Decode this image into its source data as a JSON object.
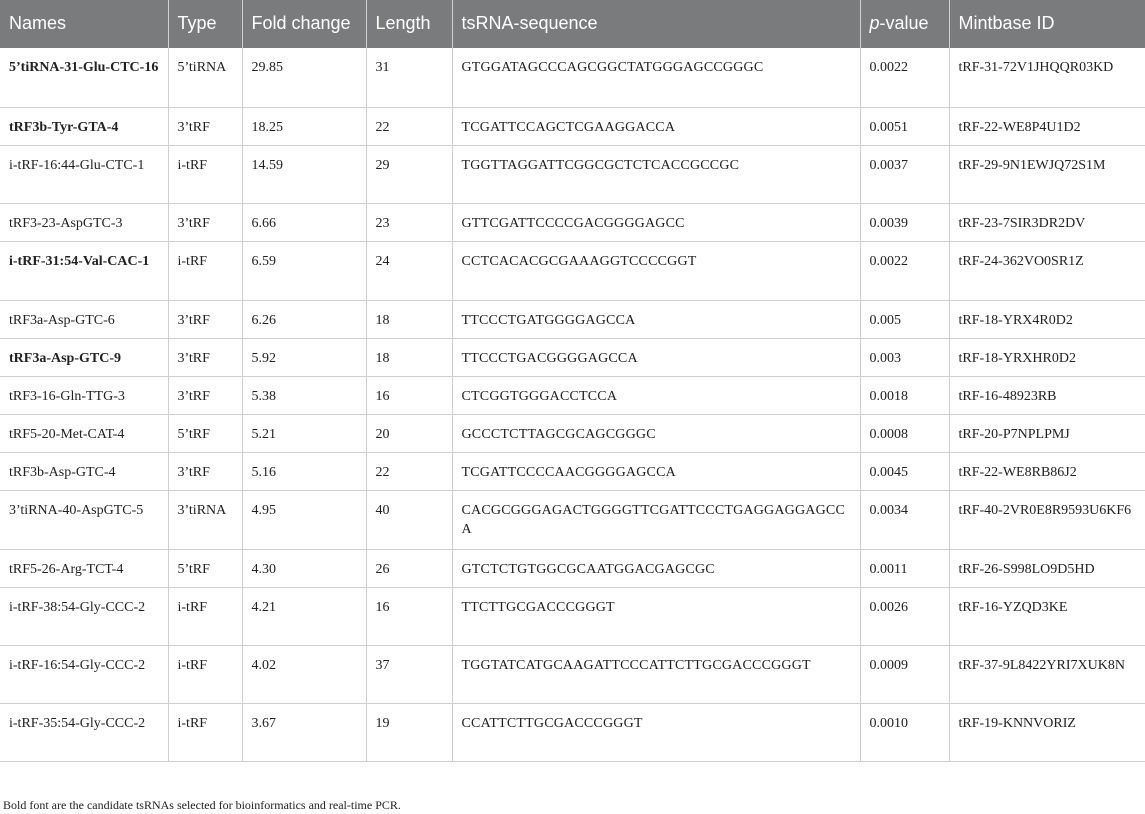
{
  "header": {
    "names": "Names",
    "type": "Type",
    "fold_change": "Fold change",
    "length": "Length",
    "sequence": "tsRNA-sequence",
    "p_italic": "p",
    "p_rest": "-value",
    "mintbase": "Mintbase ID"
  },
  "rows": [
    {
      "name": "5’tiRNA-31-Glu-CTC-16",
      "bold": true,
      "type": "5’tiRNA",
      "fold": "29.85",
      "length": "31",
      "seq": "GTGGATAGCCCAGCGGCTATGGGAGCCGGGC",
      "p": "0.0022",
      "mint": "tRF-31-72V1JHQQR03KD"
    },
    {
      "name": "tRF3b-Tyr-GTA-4",
      "bold": true,
      "type": "3’tRF",
      "fold": "18.25",
      "length": "22",
      "seq": "TCGATTCCAGCTCGAAGGACCA",
      "p": "0.0051",
      "mint": "tRF-22-WE8P4U1D2"
    },
    {
      "name": "i-tRF-16:44-Glu-CTC-1",
      "bold": false,
      "type": "i-tRF",
      "fold": "14.59",
      "length": "29",
      "seq": "TGGTTAGGATTCGGCGCTCTCACCGCCGC",
      "p": "0.0037",
      "mint": "tRF-29-9N1EWJQ72S1M"
    },
    {
      "name": "tRF3-23-AspGTC-3",
      "bold": false,
      "type": "3’tRF",
      "fold": "6.66",
      "length": "23",
      "seq": "GTTCGATTCCCCGACGGGGAGCC",
      "p": "0.0039",
      "mint": "tRF-23-7SIR3DR2DV"
    },
    {
      "name": "i-tRF-31:54-Val-CAC-1",
      "bold": true,
      "type": "i-tRF",
      "fold": "6.59",
      "length": "24",
      "seq": "CCTCACACGCGAAAGGTCCCCGGT",
      "p": "0.0022",
      "mint": "tRF-24-362VO0SR1Z"
    },
    {
      "name": "tRF3a-Asp-GTC-6",
      "bold": false,
      "type": "3’tRF",
      "fold": "6.26",
      "length": "18",
      "seq": "TTCCCTGATGGGGAGCCA",
      "p": "0.005",
      "mint": "tRF-18-YRX4R0D2"
    },
    {
      "name": "tRF3a-Asp-GTC-9",
      "bold": true,
      "type": "3’tRF",
      "fold": "5.92",
      "length": "18",
      "seq": "TTCCCTGACGGGGAGCCA",
      "p": "0.003",
      "mint": "tRF-18-YRXHR0D2"
    },
    {
      "name": "tRF3-16-Gln-TTG-3",
      "bold": false,
      "type": "3’tRF",
      "fold": "5.38",
      "length": "16",
      "seq": "CTCGGTGGGACCTCCA",
      "p": "0.0018",
      "mint": "tRF-16-48923RB"
    },
    {
      "name": "tRF5-20-Met-CAT-4",
      "bold": false,
      "type": "5’tRF",
      "fold": "5.21",
      "length": "20",
      "seq": "GCCCTCTTAGCGCAGCGGGC",
      "p": "0.0008",
      "mint": "tRF-20-P7NPLPMJ"
    },
    {
      "name": "tRF3b-Asp-GTC-4",
      "bold": false,
      "type": "3’tRF",
      "fold": "5.16",
      "length": "22",
      "seq": "TCGATTCCCCAACGGGGAGCCA",
      "p": "0.0045",
      "mint": "tRF-22-WE8RB86J2"
    },
    {
      "name": "3’tiRNA-40-AspGTC-5",
      "bold": false,
      "type": "3’tiRNA",
      "fold": "4.95",
      "length": "40",
      "seq": "CACGCGGGAGACTGGGGTTCGATTCCCTGAGGAGGAGCCA",
      "p": "0.0034",
      "mint": "tRF-40-2VR0E8R9593U6KF6"
    },
    {
      "name": "tRF5-26-Arg-TCT-4",
      "bold": false,
      "type": "5’tRF",
      "fold": "4.30",
      "length": "26",
      "seq": "GTCTCTGTGGCGCAATGGACGAGCGC",
      "p": "0.0011",
      "mint": "tRF-26-S998LO9D5HD"
    },
    {
      "name": "i-tRF-38:54-Gly-CCC-2",
      "bold": false,
      "type": "i-tRF",
      "fold": "4.21",
      "length": "16",
      "seq": "TTCTTGCGACCCGGGT",
      "p": "0.0026",
      "mint": "tRF-16-YZQD3KE"
    },
    {
      "name": "i-tRF-16:54-Gly-CCC-2",
      "bold": false,
      "type": "i-tRF",
      "fold": "4.02",
      "length": "37",
      "seq": "TGGTATCATGCAAGATTCCCATTCTTGCGACCCGGGT",
      "p": "0.0009",
      "mint": "tRF-37-9L8422YRI7XUK8N"
    },
    {
      "name": "i-tRF-35:54-Gly-CCC-2",
      "bold": false,
      "type": "i-tRF",
      "fold": "3.67",
      "length": "19",
      "seq": "CCATTCTTGCGACCCGGGT",
      "p": "0.0010",
      "mint": "tRF-19-KNNVORIZ"
    }
  ],
  "footnote": "Bold font are the candidate tsRNAs selected for bioinformatics and real-time PCR."
}
